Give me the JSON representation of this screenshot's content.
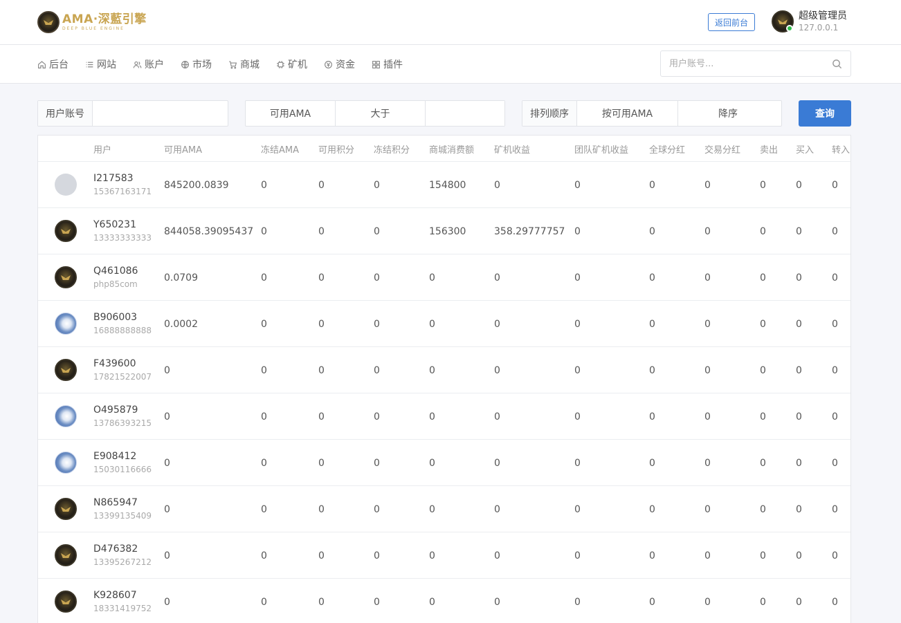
{
  "header": {
    "logo_main": "AMA·深藍引擎",
    "logo_sub": "DEEP BLUE ENGINE",
    "front_button": "返回前台",
    "admin_name": "超级管理员",
    "admin_ip": "127.0.0.1"
  },
  "nav": {
    "items": [
      {
        "label": "后台",
        "icon": "home-icon"
      },
      {
        "label": "网站",
        "icon": "list-icon"
      },
      {
        "label": "账户",
        "icon": "users-icon"
      },
      {
        "label": "市场",
        "icon": "globe-icon"
      },
      {
        "label": "商城",
        "icon": "cart-icon"
      },
      {
        "label": "矿机",
        "icon": "chip-icon"
      },
      {
        "label": "资金",
        "icon": "coin-icon"
      },
      {
        "label": "插件",
        "icon": "grid-icon"
      }
    ],
    "search_placeholder": "用户账号..."
  },
  "filter": {
    "account_label": "用户账号",
    "account_value": "",
    "field_select": "可用AMA",
    "compare_select": "大于",
    "compare_value": "",
    "sort_label": "排列顺序",
    "sort_field": "按可用AMA",
    "sort_order": "降序",
    "query_button": "查询"
  },
  "table": {
    "columns": [
      "用户",
      "可用AMA",
      "冻结AMA",
      "可用积分",
      "冻结积分",
      "商城消费额",
      "矿机收益",
      "团队矿机收益",
      "全球分红",
      "交易分红",
      "卖出",
      "买入",
      "转入"
    ],
    "rows": [
      {
        "avatar": "gray",
        "name": "I217583",
        "phone": "15367163171",
        "values": [
          "845200.0839",
          "0",
          "0",
          "0",
          "154800",
          "0",
          "0",
          "0",
          "0",
          "0",
          "0",
          "0"
        ]
      },
      {
        "avatar": "eagle",
        "name": "Y650231",
        "phone": "13333333333",
        "values": [
          "844058.39095437",
          "0",
          "0",
          "0",
          "156300",
          "358.29777757",
          "0",
          "0",
          "0",
          "0",
          "0",
          "0"
        ]
      },
      {
        "avatar": "eagle",
        "name": "Q461086",
        "phone": "php85com",
        "values": [
          "0.0709",
          "0",
          "0",
          "0",
          "0",
          "0",
          "0",
          "0",
          "0",
          "0",
          "0",
          "0"
        ]
      },
      {
        "avatar": "blue",
        "name": "B906003",
        "phone": "16888888888",
        "values": [
          "0.0002",
          "0",
          "0",
          "0",
          "0",
          "0",
          "0",
          "0",
          "0",
          "0",
          "0",
          "0"
        ]
      },
      {
        "avatar": "eagle",
        "name": "F439600",
        "phone": "17821522007",
        "values": [
          "0",
          "0",
          "0",
          "0",
          "0",
          "0",
          "0",
          "0",
          "0",
          "0",
          "0",
          "0"
        ]
      },
      {
        "avatar": "blue",
        "name": "O495879",
        "phone": "13786393215",
        "values": [
          "0",
          "0",
          "0",
          "0",
          "0",
          "0",
          "0",
          "0",
          "0",
          "0",
          "0",
          "0"
        ]
      },
      {
        "avatar": "blue",
        "name": "E908412",
        "phone": "15030116666",
        "values": [
          "0",
          "0",
          "0",
          "0",
          "0",
          "0",
          "0",
          "0",
          "0",
          "0",
          "0",
          "0"
        ]
      },
      {
        "avatar": "eagle",
        "name": "N865947",
        "phone": "13399135409",
        "values": [
          "0",
          "0",
          "0",
          "0",
          "0",
          "0",
          "0",
          "0",
          "0",
          "0",
          "0",
          "0"
        ]
      },
      {
        "avatar": "eagle",
        "name": "D476382",
        "phone": "13395267212",
        "values": [
          "0",
          "0",
          "0",
          "0",
          "0",
          "0",
          "0",
          "0",
          "0",
          "0",
          "0",
          "0"
        ]
      },
      {
        "avatar": "eagle",
        "name": "K928607",
        "phone": "18331419752",
        "values": [
          "0",
          "0",
          "0",
          "0",
          "0",
          "0",
          "0",
          "0",
          "0",
          "0",
          "0",
          "0"
        ]
      }
    ]
  },
  "colors": {
    "accent": "#3a7bd5",
    "online": "#2fbd4c",
    "logo_gold": "#c9a552"
  }
}
